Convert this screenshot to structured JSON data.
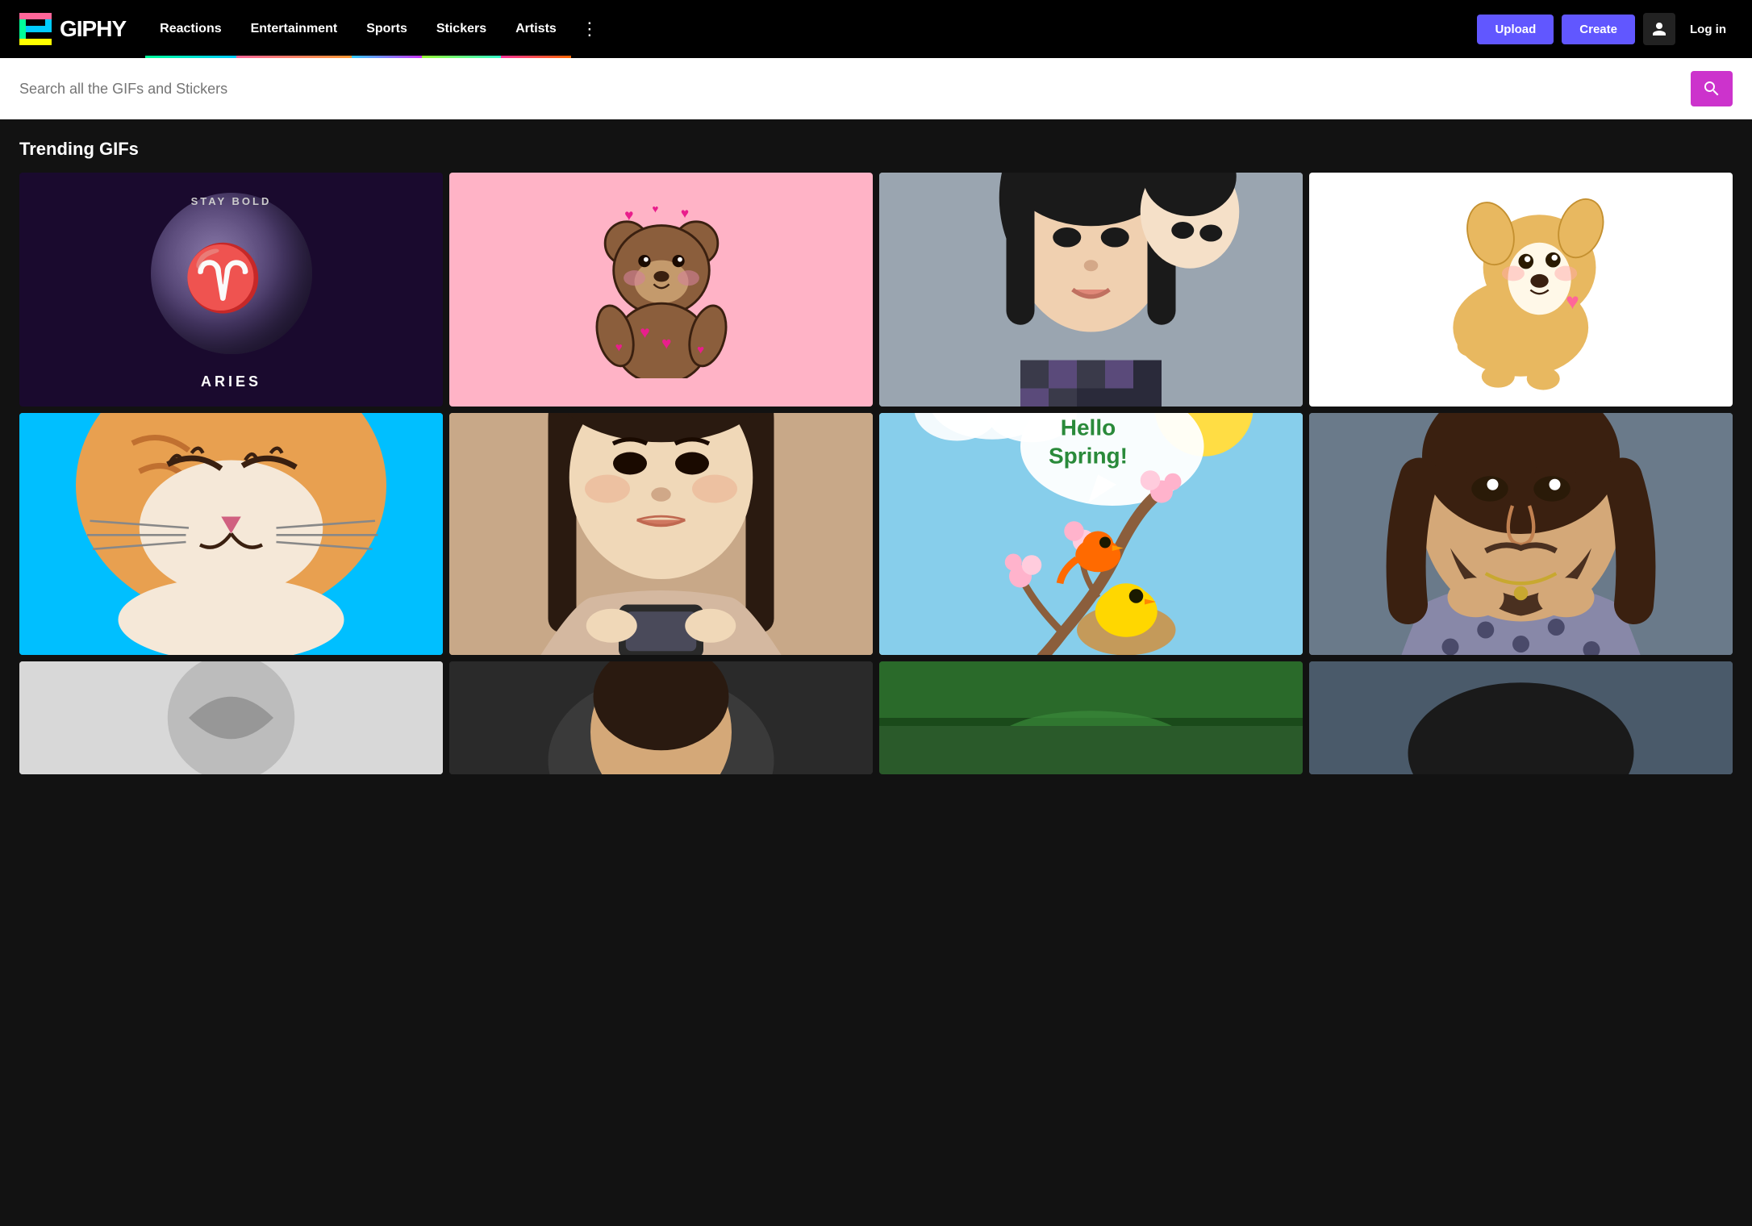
{
  "navbar": {
    "logo_text": "GIPHY",
    "nav_items": [
      {
        "id": "reactions",
        "label": "Reactions",
        "class": "reactions"
      },
      {
        "id": "entertainment",
        "label": "Entertainment",
        "class": "entertainment"
      },
      {
        "id": "sports",
        "label": "Sports",
        "class": "sports"
      },
      {
        "id": "stickers",
        "label": "Stickers",
        "class": "stickers"
      },
      {
        "id": "artists",
        "label": "Artists",
        "class": "artists"
      }
    ],
    "upload_label": "Upload",
    "create_label": "Create",
    "login_label": "Log in"
  },
  "search": {
    "placeholder": "Search all the GIFs and Stickers"
  },
  "trending": {
    "title": "Trending GIFs"
  },
  "gifs": {
    "row1": [
      {
        "id": "aries",
        "type": "aries",
        "stay_bold": "STAY BOLD",
        "symbol": "♈",
        "label": "ARIES"
      },
      {
        "id": "bear",
        "type": "bear"
      },
      {
        "id": "girl",
        "type": "girl"
      },
      {
        "id": "corgi",
        "type": "corgi"
      }
    ],
    "row2": [
      {
        "id": "cat",
        "type": "cat"
      },
      {
        "id": "kim",
        "type": "kim"
      },
      {
        "id": "spring",
        "type": "spring",
        "text": "Hello Spring!"
      },
      {
        "id": "man",
        "type": "man"
      }
    ],
    "row3": [
      {
        "id": "bottom-left",
        "type": "bottom-left"
      },
      {
        "id": "bottom-right",
        "type": "bottom-right"
      }
    ]
  }
}
